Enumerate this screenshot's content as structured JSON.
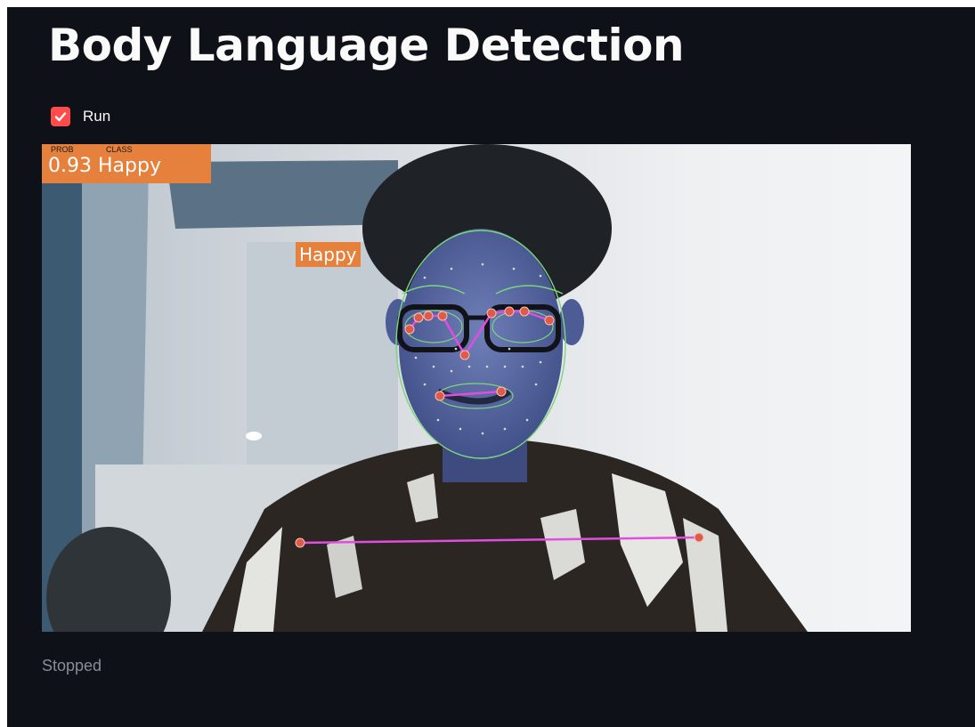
{
  "page": {
    "title": "Body Language Detection",
    "run_label": "Run",
    "run_checked": true,
    "status_text": "Stopped"
  },
  "video": {
    "overlay": {
      "prob_header": "PROB",
      "class_header": "CLASS",
      "prob_value": "0.93",
      "class_value": "Happy"
    },
    "face_label": "Happy"
  },
  "colors": {
    "background": "#0e1117",
    "accent": "#ff4b4b",
    "overlay_box": "#e5813c",
    "status_text": "#8a8d96"
  },
  "icons": {
    "checkbox": "check-icon"
  }
}
